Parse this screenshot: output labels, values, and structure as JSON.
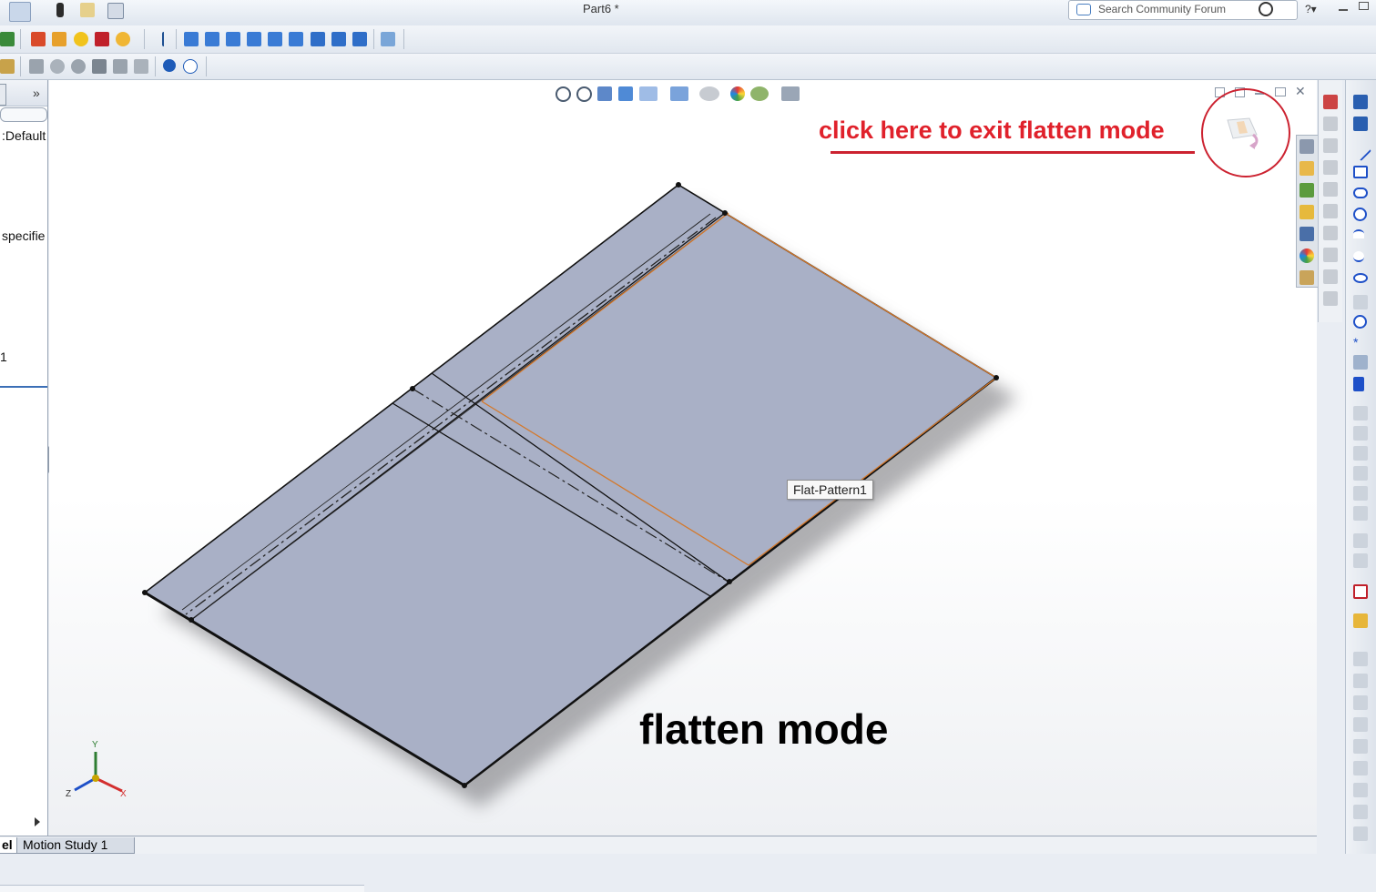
{
  "window": {
    "title": "Part6 *"
  },
  "search": {
    "placeholder": "Search Community Forum"
  },
  "left_panel": {
    "collapse_label": "»",
    "config_text": ":Default",
    "spec_text": "specifie",
    "item_text": "1"
  },
  "viewport": {
    "annotation": "click here to exit flatten mode",
    "mode_label": "flatten mode",
    "tooltip": "Flat-Pattern1",
    "triad": {
      "y": "Y",
      "z": "Z",
      "x": "X"
    }
  },
  "bottom_tabs": {
    "model_tab": "el",
    "motion_tab": "Motion Study 1"
  },
  "colors": {
    "sheet_fill": "#a9b0c6",
    "bend_line": "#d4782a",
    "annotation_red": "#e0212b"
  },
  "icons": {
    "toolbar1": [
      "select-arrow-icon",
      "traffic-light-icon",
      "file-properties-icon",
      "options-icon",
      "rebuild-icon",
      "appearance-icon",
      "check-icon",
      "color-icon",
      "edit-appearance-icon",
      "anchor-icon",
      "front-view-icon",
      "back-view-icon",
      "left-view-icon",
      "right-view-icon",
      "top-view-icon",
      "isometric-view-icon",
      "trimetric-view-icon",
      "dimetric-view-icon",
      "measure-icon"
    ],
    "toolbar2": [
      "import-icon",
      "sketch-icon",
      "loop-icon",
      "cog-icon",
      "table-icon",
      "table2-icon",
      "table3-icon",
      "help-icon",
      "info-icon"
    ]
  }
}
